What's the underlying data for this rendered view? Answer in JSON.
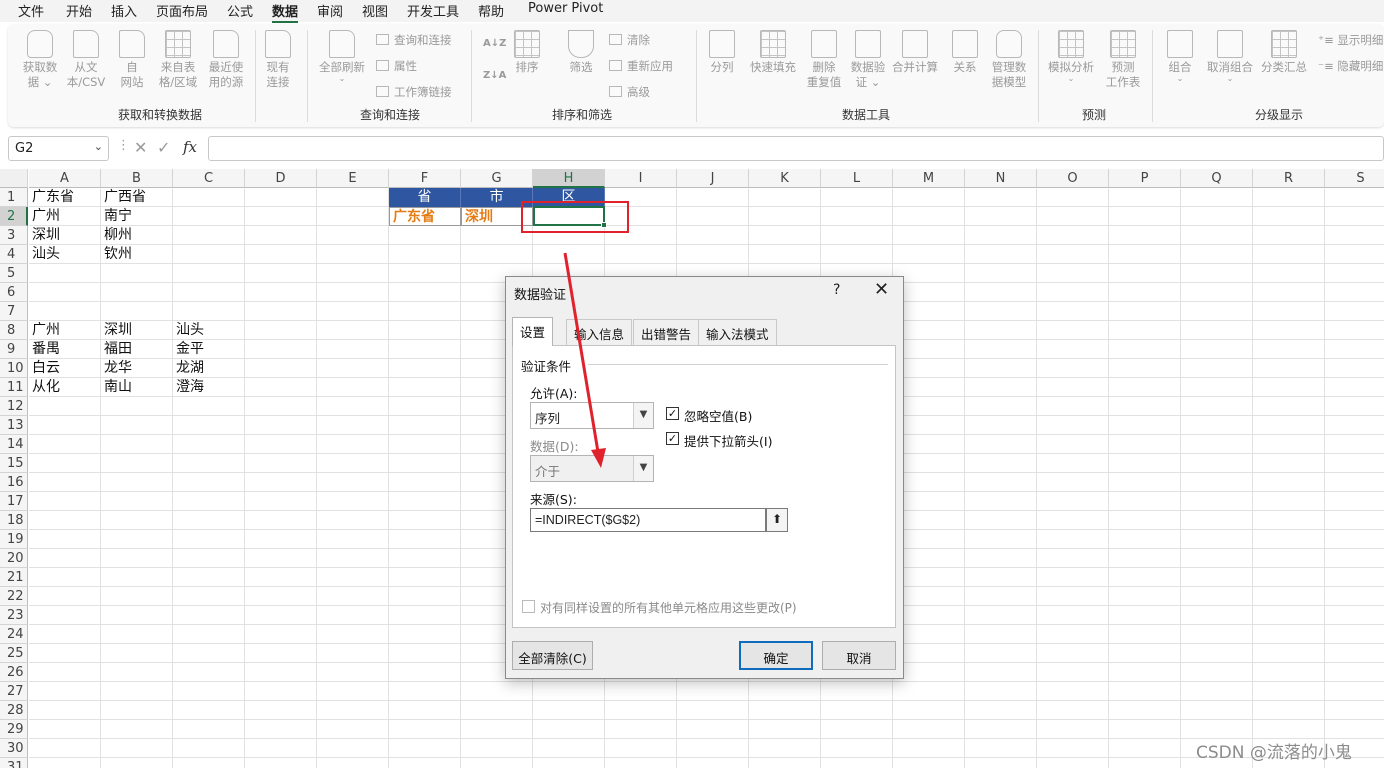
{
  "menu": {
    "tabs": [
      "文件",
      "开始",
      "插入",
      "页面布局",
      "公式",
      "数据",
      "审阅",
      "视图",
      "开发工具",
      "帮助",
      "Power Pivot"
    ],
    "active": "数据"
  },
  "ribbon": {
    "get_data": {
      "line1": "获取数",
      "line2": "据"
    },
    "from_text": {
      "line1": "从文",
      "line2": "本/CSV"
    },
    "from_web": {
      "line1": "自",
      "line2": "网站"
    },
    "from_table": {
      "line1": "来自表",
      "line2": "格/区域"
    },
    "recent": {
      "line1": "最近使",
      "line2": "用的源"
    },
    "existing": {
      "line1": "现有",
      "line2": "连接"
    },
    "group_get": "获取和转换数据",
    "refresh_all": {
      "line1": "全部刷新"
    },
    "queries": "查询和连接",
    "properties": "属性",
    "workbook_links": "工作簿链接",
    "group_queries": "查询和连接",
    "sort": "排序",
    "filter": "筛选",
    "clear": "清除",
    "reapply": "重新应用",
    "advanced": "高级",
    "group_sort": "排序和筛选",
    "split": "分列",
    "flash_fill": "快速填充",
    "remove_dup": {
      "line1": "删除",
      "line2": "重复值"
    },
    "data_validation": {
      "line1": "数据验",
      "line2": "证"
    },
    "consolidate": "合并计算",
    "relationships": "关系",
    "data_model": {
      "line1": "管理数",
      "line2": "据模型"
    },
    "group_tools": "数据工具",
    "whatif": {
      "line1": "模拟分析"
    },
    "forecast": {
      "line1": "预测",
      "line2": "工作表"
    },
    "group_forecast": "预测",
    "group_btn": {
      "line1": "组合"
    },
    "ungroup": {
      "line1": "取消组合"
    },
    "subtotal": {
      "line1": "分类汇总"
    },
    "show_detail": "显示明细",
    "hide_detail": "隐藏明细",
    "group_outline": "分级显示"
  },
  "formula_bar": {
    "name_box": "G2",
    "fx": "fx",
    "formula": ""
  },
  "sheet": {
    "columns": [
      "A",
      "B",
      "C",
      "D",
      "E",
      "F",
      "G",
      "H",
      "I",
      "J",
      "K",
      "L",
      "M",
      "N",
      "O",
      "P",
      "Q",
      "R",
      "S"
    ],
    "rows": [
      "1",
      "2",
      "3",
      "4",
      "5",
      "6",
      "7",
      "8",
      "9",
      "10",
      "11",
      "12",
      "13",
      "14",
      "15",
      "16",
      "17",
      "18",
      "19",
      "20",
      "21",
      "22",
      "23",
      "24",
      "25",
      "26",
      "27",
      "28",
      "29",
      "30",
      "31"
    ],
    "cells": {
      "A1": "广东省",
      "B1": "广西省",
      "A2": "广州",
      "B2": "南宁",
      "A3": "深圳",
      "B3": "柳州",
      "A4": "汕头",
      "B4": "钦州",
      "A8": "广州",
      "B8": "深圳",
      "C8": "汕头",
      "A9": "番禺",
      "B9": "福田",
      "C9": "金平",
      "A10": "白云",
      "B10": "龙华",
      "C10": "龙湖",
      "A11": "从化",
      "B11": "南山",
      "C11": "澄海",
      "F1": "省",
      "G1": "市",
      "H1": "区",
      "F2": "广东省",
      "G2": "深圳"
    },
    "header_color": "#2f56a0",
    "highlight_color": "#e57c13"
  },
  "dialog": {
    "title": "数据验证",
    "help": "?",
    "close": "✕",
    "tabs": [
      "设置",
      "输入信息",
      "出错警告",
      "输入法模式"
    ],
    "section": "验证条件",
    "allow_label": "允许(A):",
    "allow_value": "序列",
    "ignore_blank": "忽略空值(B)",
    "dropdown_arrow": "提供下拉箭头(I)",
    "data_label": "数据(D):",
    "data_value": "介于",
    "source_label": "来源(S):",
    "source_value": "=INDIRECT($G$2)",
    "apply_all": "对有同样设置的所有其他单元格应用这些更改(P)",
    "clear_all": "全部清除(C)",
    "ok": "确定",
    "cancel": "取消"
  },
  "annotation_color": "#e0222d",
  "watermark": "CSDN @流落的小鬼"
}
